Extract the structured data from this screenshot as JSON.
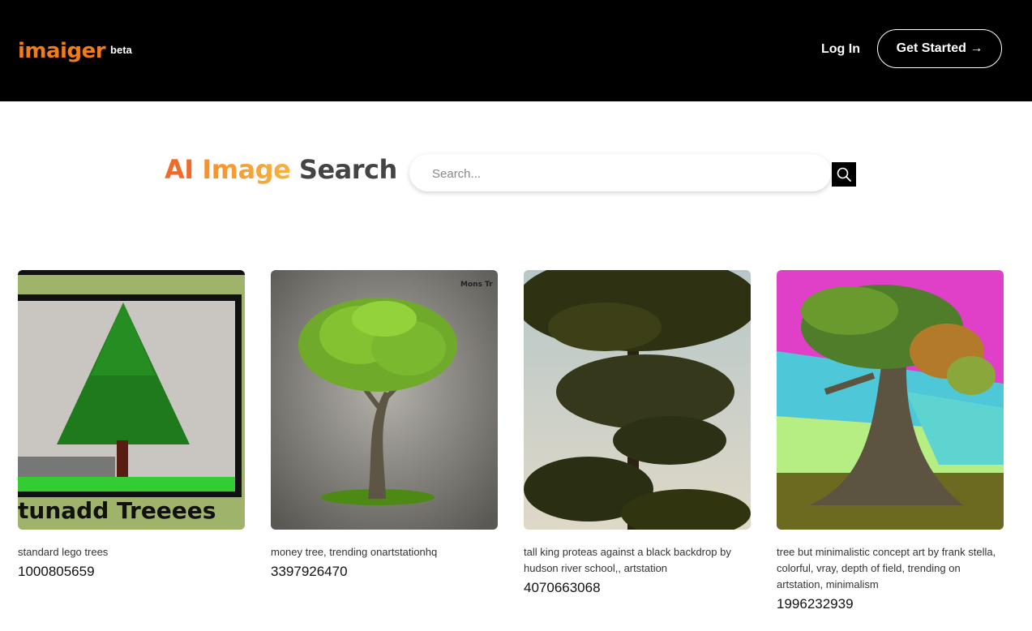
{
  "header": {
    "logo_text": "imaiger",
    "logo_badge": "beta",
    "login_label": "Log In",
    "get_started_label": "Get Started →"
  },
  "hero": {
    "title_part1": "AI",
    "title_part2": "Image",
    "title_part3": "Search",
    "search_placeholder": "Search..."
  },
  "results": [
    {
      "caption": "standard lego trees",
      "seed": "1000805659",
      "image_text": "tunadd  Treeees"
    },
    {
      "caption": "money tree, trending onartstationhq",
      "seed": "3397926470",
      "image_text": "Mons Tr"
    },
    {
      "caption": "tall king proteas against a black backdrop by hudson river school,, artstation",
      "seed": "4070663068"
    },
    {
      "caption": "tree but minimalistic concept art by frank stella, colorful, vray, depth of field, trending on artstation, minimalism",
      "seed": "1996232939"
    }
  ],
  "colors": {
    "brand_orange": "#f07d1a",
    "header_bg": "#000000"
  }
}
